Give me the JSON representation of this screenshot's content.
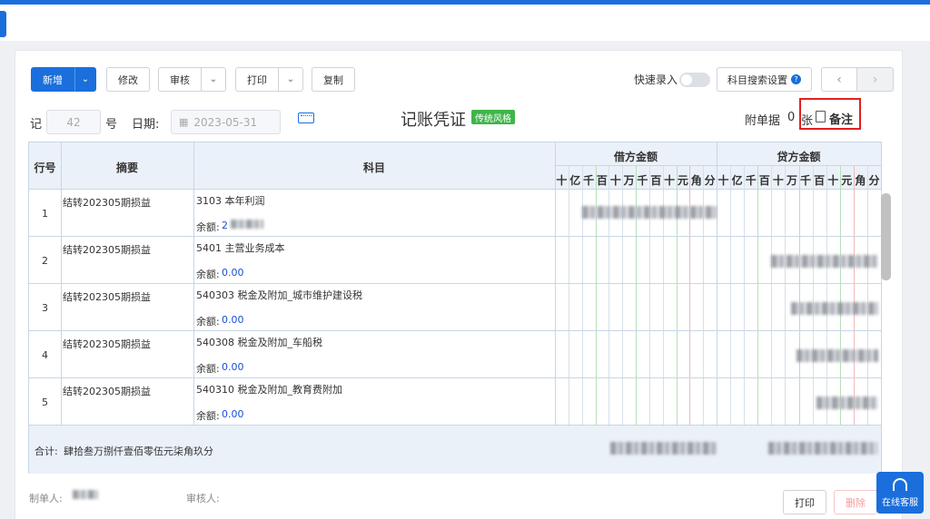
{
  "toolbar": {
    "new_label": "新增",
    "edit_label": "修改",
    "review_label": "审核",
    "print_label": "打印",
    "copy_label": "复制",
    "quick_entry_label": "快速录入",
    "subject_search_label": "科目搜索设置"
  },
  "voucher": {
    "word_label": "记",
    "number": "42",
    "number_suffix": "号",
    "date_label": "日期:",
    "date_value": "2023-05-31",
    "title": "记账凭证",
    "style_tag": "传统风格",
    "attach_label": "附单据",
    "attach_count": "0",
    "attach_unit": "张",
    "remark_label": "备注"
  },
  "table": {
    "headers": {
      "line_no": "行号",
      "summary": "摘要",
      "subject": "科目",
      "debit": "借方金额",
      "credit": "贷方金额"
    },
    "digits": [
      "十",
      "亿",
      "千",
      "百",
      "十",
      "万",
      "千",
      "百",
      "十",
      "元",
      "角",
      "分"
    ],
    "balance_label": "余额:",
    "rows": [
      {
        "no": "1",
        "summary": "结转202305期损益",
        "subject": "3103 本年利润",
        "balance": "2"
      },
      {
        "no": "2",
        "summary": "结转202305期损益",
        "subject": "5401 主营业务成本",
        "balance": "0.00"
      },
      {
        "no": "3",
        "summary": "结转202305期损益",
        "subject": "540303 税金及附加_城市维护建设税",
        "balance": "0.00"
      },
      {
        "no": "4",
        "summary": "结转202305期损益",
        "subject": "540308 税金及附加_车船税",
        "balance": "0.00"
      },
      {
        "no": "5",
        "summary": "结转202305期损益",
        "subject": "540310 税金及附加_教育费附加",
        "balance": "0.00"
      }
    ],
    "total_label": "合计:",
    "total_words": "肆拾叁万捌仟壹佰零伍元柒角玖分"
  },
  "footer": {
    "maker_label": "制单人:",
    "reviewer_label": "审核人:",
    "print_label": "打印",
    "delete_label": "删除",
    "service_label": "在线客服"
  },
  "colors": {
    "primary": "#1a6fdc",
    "tag_green": "#3fb54b",
    "highlight_red": "#e02020"
  }
}
